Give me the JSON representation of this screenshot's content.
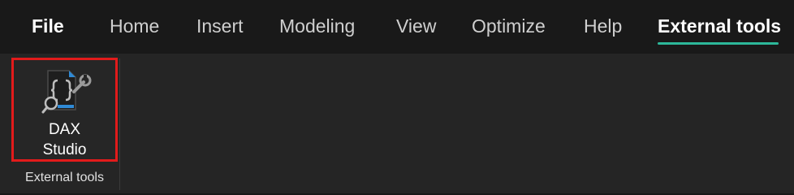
{
  "tabs": [
    {
      "label": "File"
    },
    {
      "label": "Home"
    },
    {
      "label": "Insert"
    },
    {
      "label": "Modeling"
    },
    {
      "label": "View"
    },
    {
      "label": "Optimize"
    },
    {
      "label": "Help"
    },
    {
      "label": "External tools"
    }
  ],
  "active_tab": "External tools",
  "ribbon": {
    "group_label": "External tools",
    "dax_button": {
      "line1": "DAX",
      "line2": "Studio",
      "icon": "dax-studio-icon"
    }
  },
  "colors": {
    "active_underline": "#2db89a",
    "highlight_border": "#e21b1b",
    "icon_accent": "#2f8ad6"
  }
}
